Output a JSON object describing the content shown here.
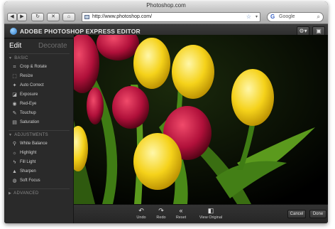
{
  "window": {
    "title": "Photoshop.com"
  },
  "browser": {
    "url": "http://www.photoshop.com/",
    "search_placeholder": "Google",
    "search_engine_glyph": "G"
  },
  "app": {
    "title": "ADOBE PHOTOSHOP EXPRESS EDITOR",
    "accent_color": "#2a78c9"
  },
  "sidebar": {
    "tabs": [
      {
        "label": "Edit",
        "active": true
      },
      {
        "label": "Decorate",
        "active": false
      }
    ],
    "sections": [
      {
        "label": "BASIC",
        "expanded": true,
        "items": [
          {
            "label": "Crop & Rotate",
            "icon": "crop-icon"
          },
          {
            "label": "Resize",
            "icon": "resize-icon"
          },
          {
            "label": "Auto Correct",
            "icon": "magic-wand-icon"
          },
          {
            "label": "Exposure",
            "icon": "exposure-icon"
          },
          {
            "label": "Red-Eye",
            "icon": "eye-icon"
          },
          {
            "label": "Touchup",
            "icon": "brush-icon"
          },
          {
            "label": "Saturation",
            "icon": "saturation-icon"
          }
        ]
      },
      {
        "label": "ADJUSTMENTS",
        "expanded": true,
        "items": [
          {
            "label": "White Balance",
            "icon": "thermometer-icon"
          },
          {
            "label": "Highlight",
            "icon": "lightbulb-icon"
          },
          {
            "label": "Fill Light",
            "icon": "flash-icon"
          },
          {
            "label": "Sharpen",
            "icon": "sharpen-icon"
          },
          {
            "label": "Soft Focus",
            "icon": "soft-focus-icon"
          }
        ]
      },
      {
        "label": "ADVANCED",
        "expanded": false,
        "items": []
      }
    ]
  },
  "bottombar": {
    "undo_label": "Undo",
    "redo_label": "Redo",
    "reset_label": "Reset",
    "view_original_label": "View Original",
    "cancel_label": "Cancel",
    "done_label": "Done"
  }
}
